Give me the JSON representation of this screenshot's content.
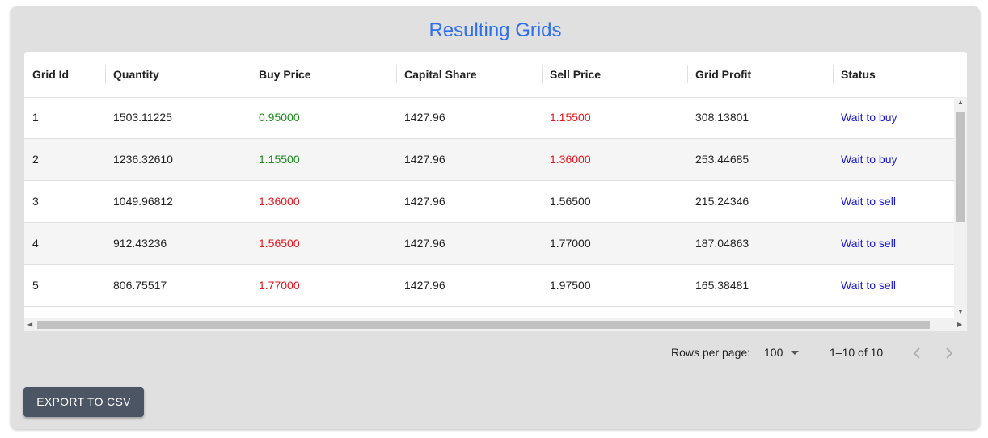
{
  "title": "Resulting Grids",
  "table": {
    "columns": [
      "Grid Id",
      "Quantity",
      "Buy Price",
      "Capital Share",
      "Sell Price",
      "Grid Profit",
      "Status"
    ],
    "rows": [
      [
        "1",
        "1503.11225",
        "0.95000",
        "1427.96",
        "1.15500",
        "308.13801",
        "Wait to buy"
      ],
      [
        "2",
        "1236.32610",
        "1.15500",
        "1427.96",
        "1.36000",
        "253.44685",
        "Wait to buy"
      ],
      [
        "3",
        "1049.96812",
        "1.36000",
        "1427.96",
        "1.56500",
        "215.24346",
        "Wait to sell"
      ],
      [
        "4",
        "912.43236",
        "1.56500",
        "1427.96",
        "1.77000",
        "187.04863",
        "Wait to sell"
      ],
      [
        "5",
        "806.75517",
        "1.77000",
        "1427.96",
        "1.97500",
        "165.38481",
        "Wait to sell"
      ]
    ],
    "cell_colors": [
      [
        "",
        "",
        "green",
        "",
        "red",
        "",
        "blue"
      ],
      [
        "",
        "",
        "green",
        "",
        "red",
        "",
        "blue"
      ],
      [
        "",
        "",
        "red",
        "",
        "",
        "",
        "blue"
      ],
      [
        "",
        "",
        "red",
        "",
        "",
        "",
        "blue"
      ],
      [
        "",
        "",
        "red",
        "",
        "",
        "",
        "blue"
      ]
    ]
  },
  "pagination": {
    "rows_per_page_label": "Rows per page:",
    "rows_per_page_value": "100",
    "range_text": "1–10 of 10"
  },
  "export_label": "EXPORT TO CSV",
  "colors": {
    "title": "#2f6fea",
    "buy_green": "#1e8a1e",
    "sell_red": "#e8141e",
    "status_blue": "#1a1ad6",
    "button_bg": "#4b5563"
  }
}
